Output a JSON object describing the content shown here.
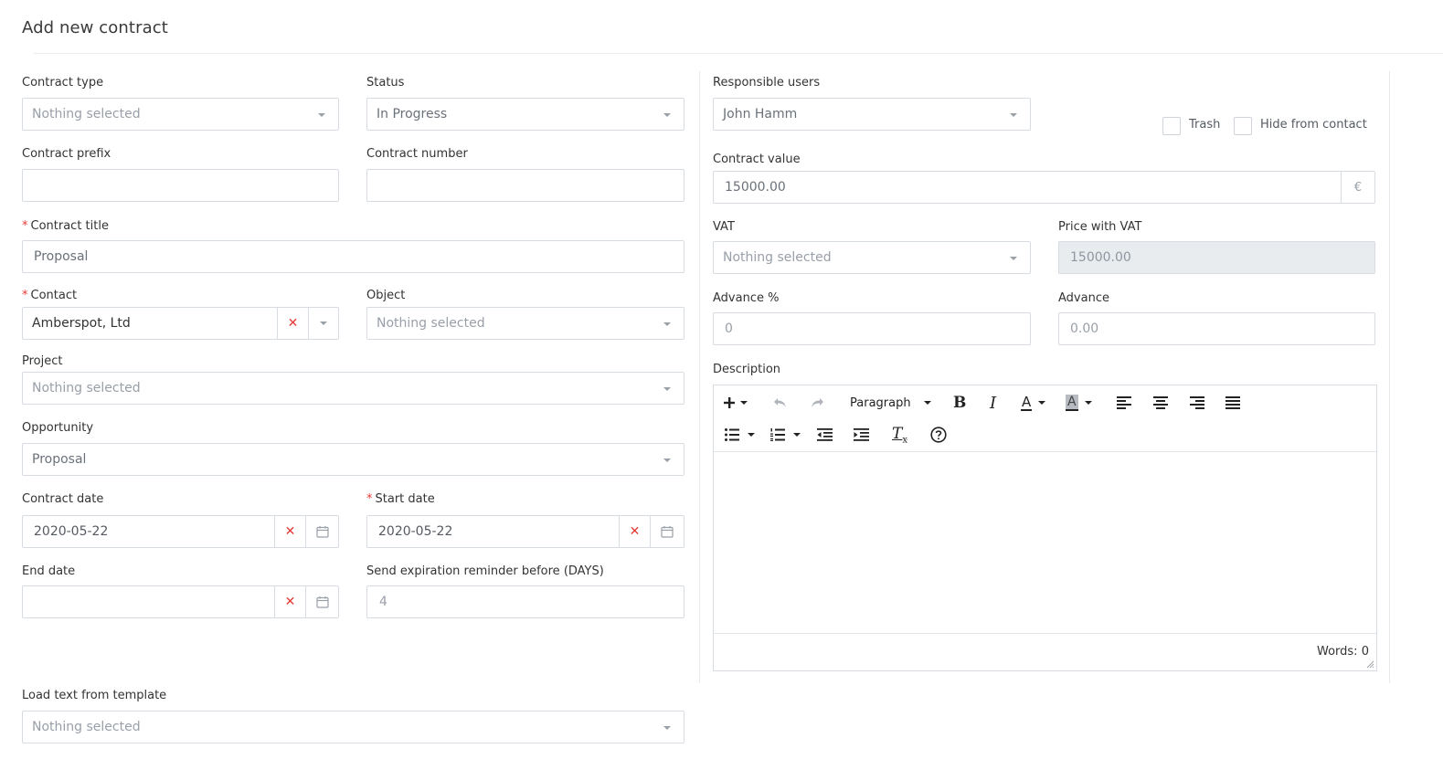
{
  "page": {
    "title": "Add new contract"
  },
  "left": {
    "contract_type": {
      "label": "Contract type",
      "value": "Nothing selected"
    },
    "status": {
      "label": "Status",
      "value": "In Progress"
    },
    "contract_prefix": {
      "label": "Contract prefix",
      "value": ""
    },
    "contract_number": {
      "label": "Contract number",
      "value": ""
    },
    "contract_title": {
      "required_mark": "*",
      "label": "Contract title",
      "value": "Proposal"
    },
    "contact": {
      "required_mark": "*",
      "label": "Contact",
      "value": "Amberspot, Ltd"
    },
    "object": {
      "label": "Object",
      "value": "Nothing selected"
    },
    "project": {
      "label": "Project",
      "value": "Nothing selected"
    },
    "opportunity": {
      "label": "Opportunity",
      "value": "Proposal"
    },
    "contract_date": {
      "label": "Contract date",
      "value": "2020-05-22"
    },
    "start_date": {
      "required_mark": "*",
      "label": "Start date",
      "value": "2020-05-22"
    },
    "end_date": {
      "label": "End date",
      "value": ""
    },
    "reminder": {
      "label": "Send expiration reminder before (DAYS)",
      "value": "4"
    },
    "template": {
      "label": "Load text from template",
      "value": "Nothing selected"
    }
  },
  "right": {
    "responsible_users": {
      "label": "Responsible users",
      "value": "John Hamm"
    },
    "trash": {
      "label": "Trash",
      "checked": false
    },
    "hide_from_contact": {
      "label": "Hide from contact",
      "checked": false
    },
    "contract_value": {
      "label": "Contract value",
      "value": "15000.00",
      "currency": "€"
    },
    "vat": {
      "label": "VAT",
      "value": "Nothing selected"
    },
    "price_with_vat": {
      "label": "Price with VAT",
      "value": "15000.00"
    },
    "advance_percent": {
      "label": "Advance %",
      "value": "0"
    },
    "advance": {
      "label": "Advance",
      "value": "0.00"
    },
    "description": {
      "label": "Description",
      "format_select": "Paragraph",
      "text_color_glyph": "A",
      "bg_color_glyph": "A",
      "words_label": "Words:",
      "words_count": "0"
    }
  },
  "colors": {
    "required": "#e53935",
    "border": "#d7dbe2",
    "placeholder": "#999fa8",
    "disabled_bg": "#e9ecef"
  },
  "icons": [
    "chevron-down-icon",
    "clear-x-icon",
    "calendar-icon",
    "plus-icon",
    "undo-icon",
    "redo-icon",
    "bold-icon",
    "italic-icon",
    "text-color-icon",
    "background-color-icon",
    "align-left-icon",
    "align-center-icon",
    "align-right-icon",
    "align-justify-icon",
    "bullet-list-icon",
    "numbered-list-icon",
    "outdent-icon",
    "indent-icon",
    "clear-formatting-icon",
    "help-icon",
    "resize-handle-icon"
  ]
}
